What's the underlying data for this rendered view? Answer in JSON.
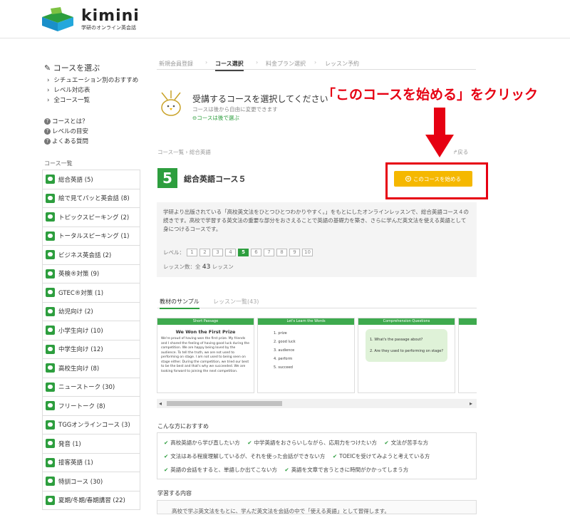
{
  "header": {
    "logo_text": "kimini",
    "logo_sub": "学研のオンライン英会話"
  },
  "sidebar": {
    "title": "✎ コースを選ぶ",
    "links": [
      "シチュエーション別のおすすめ",
      "レベル対応表",
      "全コース一覧"
    ],
    "help": [
      "コースとは？",
      "レベルの目安",
      "よくある質問"
    ],
    "list_label": "コース一覧",
    "courses": [
      "総合英語 (5)",
      "絵で見てパッと英会話 (8)",
      "トピックスピーキング (2)",
      "トータルスピーキング (1)",
      "ビジネス英会話 (2)",
      "英検®対策 (9)",
      "GTEC®対策 (1)",
      "幼児向け (2)",
      "小学生向け (10)",
      "中学生向け (12)",
      "高校生向け (8)",
      "ニューストーク (30)",
      "フリートーク (8)",
      "TGGオンラインコース (3)",
      "発音 (1)",
      "接客英語 (1)",
      "特訓コース (30)",
      "夏期/冬期/春期講習 (22)"
    ]
  },
  "steps": [
    "新規会員登録",
    "コース選択",
    "料金プラン選択",
    "レッスン予約"
  ],
  "select": {
    "title": "受講するコースを選択してください",
    "sub": "コースは後から自由に変更できます",
    "link": "⊖コースは後で選ぶ"
  },
  "callout": "「このコースを始める」をクリック",
  "breadcrumb": "コース一覧  ›  総合英語",
  "back_label": "↱戻る",
  "course": {
    "number": "5",
    "name": "総合英語コース５",
    "start_label": "このコースを始める",
    "description": "学研より出版されている「高校英文法をひとつひとつわかりやすく。」をもとにしたオンラインレッスンで、総合英語コース４の続きです。高校で学習する英文法の重要な部分をおさえることで英語の基礎力を築き、さらに学んだ英文法を使える英語として身につけるコースです。",
    "level_label": "レベル：",
    "levels": [
      "1",
      "2",
      "3",
      "4",
      "5",
      "6",
      "7",
      "8",
      "9",
      "10"
    ],
    "active_level": "5",
    "lesson_label": "レッスン数：全",
    "lesson_count": "43",
    "lesson_unit": "レッスン"
  },
  "tabs": [
    "教材のサンプル",
    "レッスン一覧(43)"
  ],
  "samples": {
    "s1": {
      "header": "Short Passage",
      "title": "We Won the First Prize",
      "body": "We're proud of having won the first prize. My friends and I shared the feeling of having good luck during the competition. We are happy being loved by the audience. To tell the truth, we are not used to performing on stage. I am not used to being seen on stage either. During the competition, we tried our best to be the best and that's why we succeeded. We are looking forward to joining the next competition."
    },
    "s2": {
      "header": "Let's Learn the Words",
      "items": [
        "1.  prize",
        "2.  good luck",
        "3.  audience",
        "4.  perform",
        "5.  succeed"
      ]
    },
    "s3": {
      "header": "Comprehension Questions",
      "q1": "1.  What's the passage about?",
      "q2": "2.  Are they used to performing on stage?"
    }
  },
  "recommend": {
    "title": "こんな方におすすめ",
    "rows": [
      [
        "高校英語から学び直したい方",
        "中学英語をおさらいしながら、応用力をつけたい方",
        "文法が苦手な方"
      ],
      [
        "文法はある程度理解しているが、それを使った会話ができない方",
        "TOEICを受けてみようと考えている方"
      ],
      [
        "英語の会話をすると、単語しか出てこない方",
        "英語を文章で言うときに時間がかかってしまう方"
      ]
    ]
  },
  "learn": {
    "title": "学習する内容",
    "text": "高校で学ぶ英文法をもとに、学んだ英文法を会話の中で「使える英語」として習得します。"
  },
  "colors": {
    "accent": "#2d9e3e",
    "button": "#f5b800",
    "callout": "#e60012"
  }
}
